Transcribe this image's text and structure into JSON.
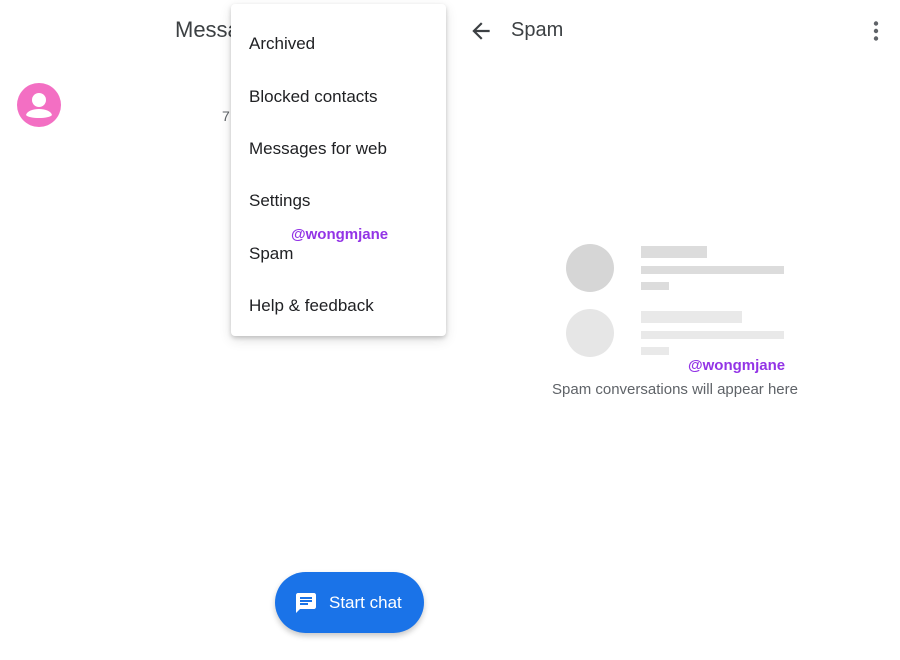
{
  "messages_pane": {
    "title": "Messa",
    "conversation_time_fragment": "7"
  },
  "overflow_menu": {
    "items": [
      {
        "label": "Archived"
      },
      {
        "label": "Blocked contacts"
      },
      {
        "label": "Messages for web"
      },
      {
        "label": "Settings"
      },
      {
        "label": "Spam"
      },
      {
        "label": "Help & feedback"
      }
    ]
  },
  "fab": {
    "label": "Start chat",
    "icon": "chat-icon",
    "color": "#1a73e8"
  },
  "spam_pane": {
    "title": "Spam",
    "back_icon": "arrow-back-icon",
    "more_icon": "more-vert-icon",
    "empty_message": "Spam conversations will appear here"
  },
  "watermark": {
    "text": "@wongmjane",
    "color": "#9334e6"
  },
  "colors": {
    "avatar": "#f36fc3",
    "placeholder_circle_dark": "#d6d6d6",
    "placeholder_circle_light": "#e6e6e6",
    "placeholder_bar_dark": "#dcdcdc",
    "placeholder_bar_light": "#e9e9e9"
  }
}
